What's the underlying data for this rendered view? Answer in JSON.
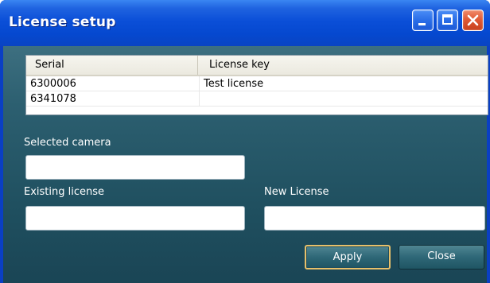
{
  "window": {
    "title": "License setup"
  },
  "title_buttons": {
    "minimize": "minimize-icon",
    "maximize": "maximize-icon",
    "close": "close-icon"
  },
  "license_table": {
    "columns": [
      "Serial",
      "License key"
    ],
    "rows": [
      [
        "6300006",
        "Test license"
      ],
      [
        "6341078",
        ""
      ]
    ]
  },
  "form": {
    "selected_camera_label": "Selected camera",
    "selected_camera_value": "",
    "existing_license_label": "Existing license",
    "existing_license_value": "",
    "new_license_label": "New License",
    "new_license_value": ""
  },
  "actions": {
    "apply_label": "Apply",
    "close_label": "Close"
  },
  "colors": {
    "titlebar": "#0b4fd8",
    "panel": "#2c5f70",
    "apply_focus_border": "#e7c06a"
  }
}
